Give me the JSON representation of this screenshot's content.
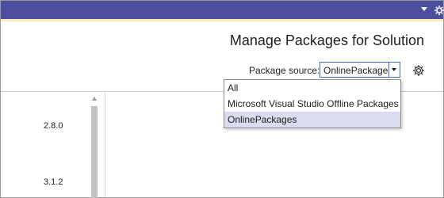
{
  "header": {
    "title": "Manage Packages for Solution",
    "package_source_label": "Package source:",
    "package_source_value": "OnlinePackages"
  },
  "versions": [
    {
      "label": "2.8.0"
    },
    {
      "label": "3.1.2"
    }
  ],
  "dropdown": {
    "options": [
      {
        "label": "All"
      },
      {
        "label": "Microsoft Visual Studio Offline Packages"
      },
      {
        "label": "OnlinePackages"
      }
    ],
    "selected_index": 2
  },
  "icons": {
    "titlebar_dropdown": "chevron-down-icon",
    "titlebar_settings": "gear-icon",
    "settings": "gear-icon",
    "scroll_up": "arrow-up-icon"
  },
  "colors": {
    "titlebar": "#4b4f9e",
    "titlebar_accent": "#fde8b8",
    "select_border": "#3c6fb5",
    "selected_option": "#dadcf0"
  }
}
